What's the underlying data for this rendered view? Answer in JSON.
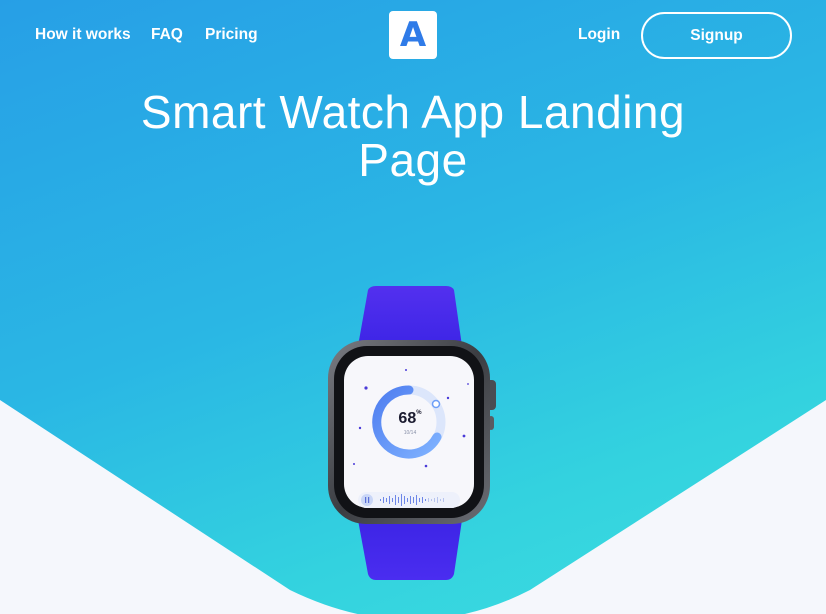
{
  "nav": {
    "links": [
      "How it works",
      "FAQ",
      "Pricing"
    ],
    "logo_letter": "A",
    "login_label": "Login",
    "signup_label": "Signup"
  },
  "hero": {
    "title": "Smart Watch App Landing Page"
  },
  "watch": {
    "value": "68",
    "unit": "%",
    "sub_label": "10/14",
    "progress_fraction": 0.68
  },
  "colors": {
    "gradient_start": "#279fe6",
    "gradient_end": "#3ddde0",
    "logo_accent": "#2f7be8",
    "strap": "#4a2df0",
    "bottom_shape": "#f5f7fc"
  },
  "icons": [
    "play-pause-icon",
    "waveform-icon"
  ]
}
